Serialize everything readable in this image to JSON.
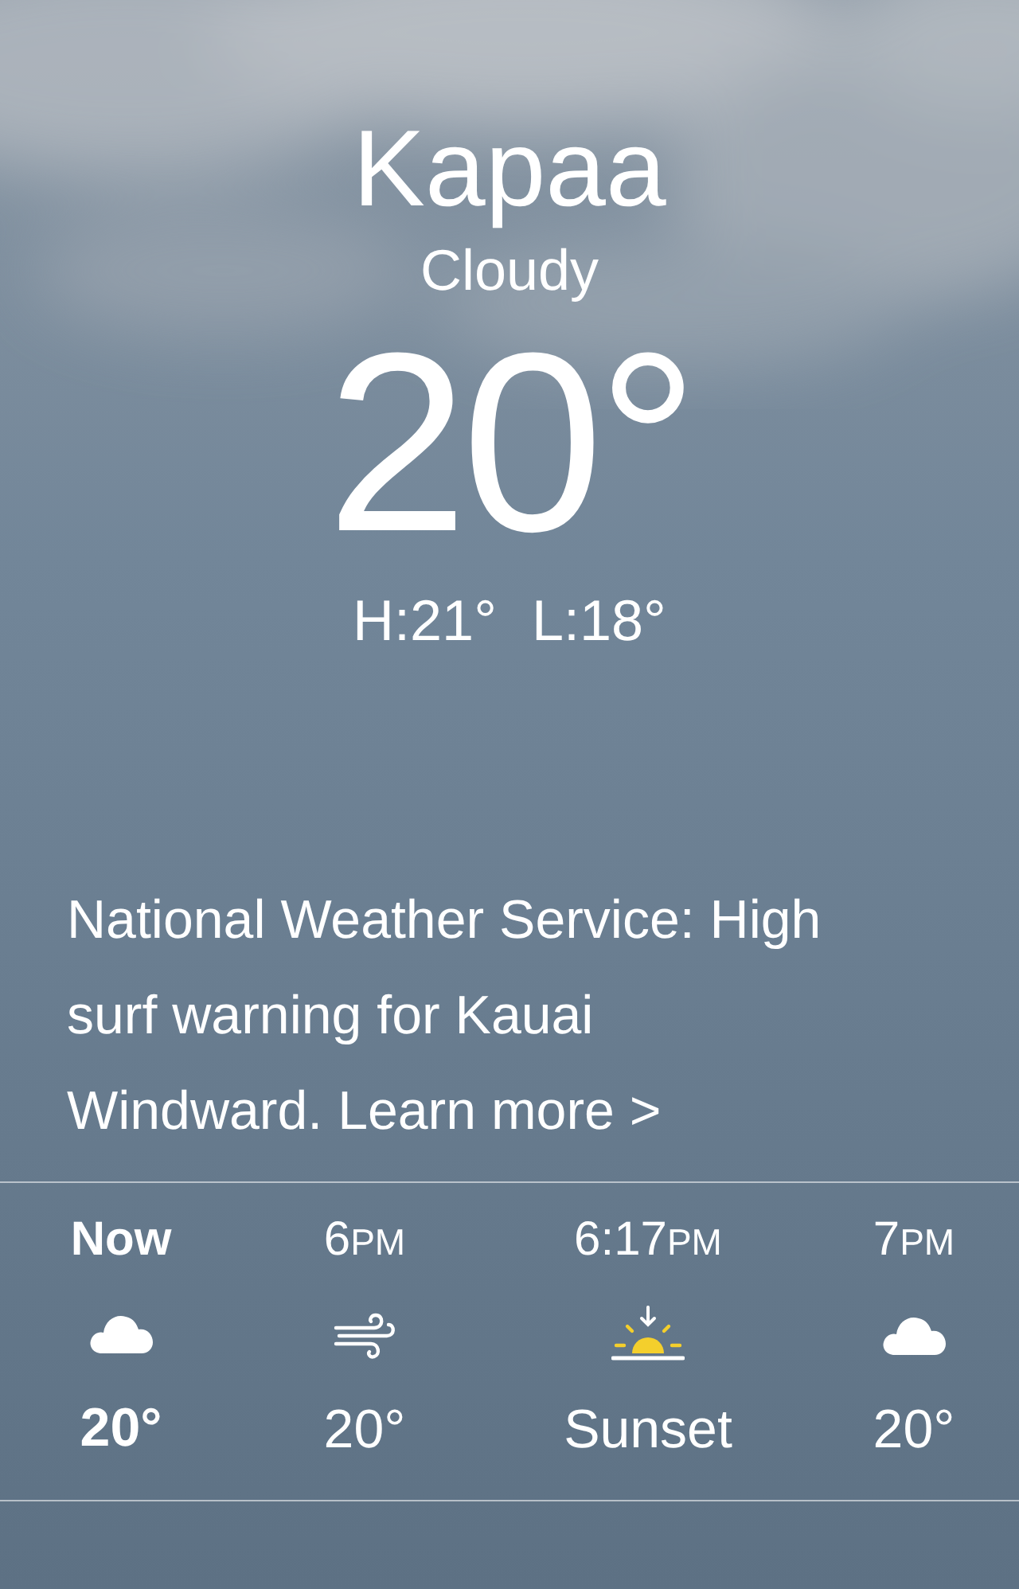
{
  "location": {
    "city": "Kapaa",
    "condition": "Cloudy",
    "temperature": "20°",
    "high": "H:21°",
    "low": "L:18°"
  },
  "alert": {
    "text": "National Weather Service: High surf warning for Kauai Windward.",
    "link": "Learn more >"
  },
  "hourly": [
    {
      "time": "Now",
      "kind": "cloud",
      "value": "20°",
      "current": true
    },
    {
      "time": "6",
      "suffix": "PM",
      "kind": "wind",
      "value": "20°",
      "current": false
    },
    {
      "time": "6:17",
      "suffix": "PM",
      "kind": "sunset",
      "value": "Sunset",
      "current": false
    },
    {
      "time": "7",
      "suffix": "PM",
      "kind": "cloud",
      "value": "20°",
      "current": false
    }
  ]
}
